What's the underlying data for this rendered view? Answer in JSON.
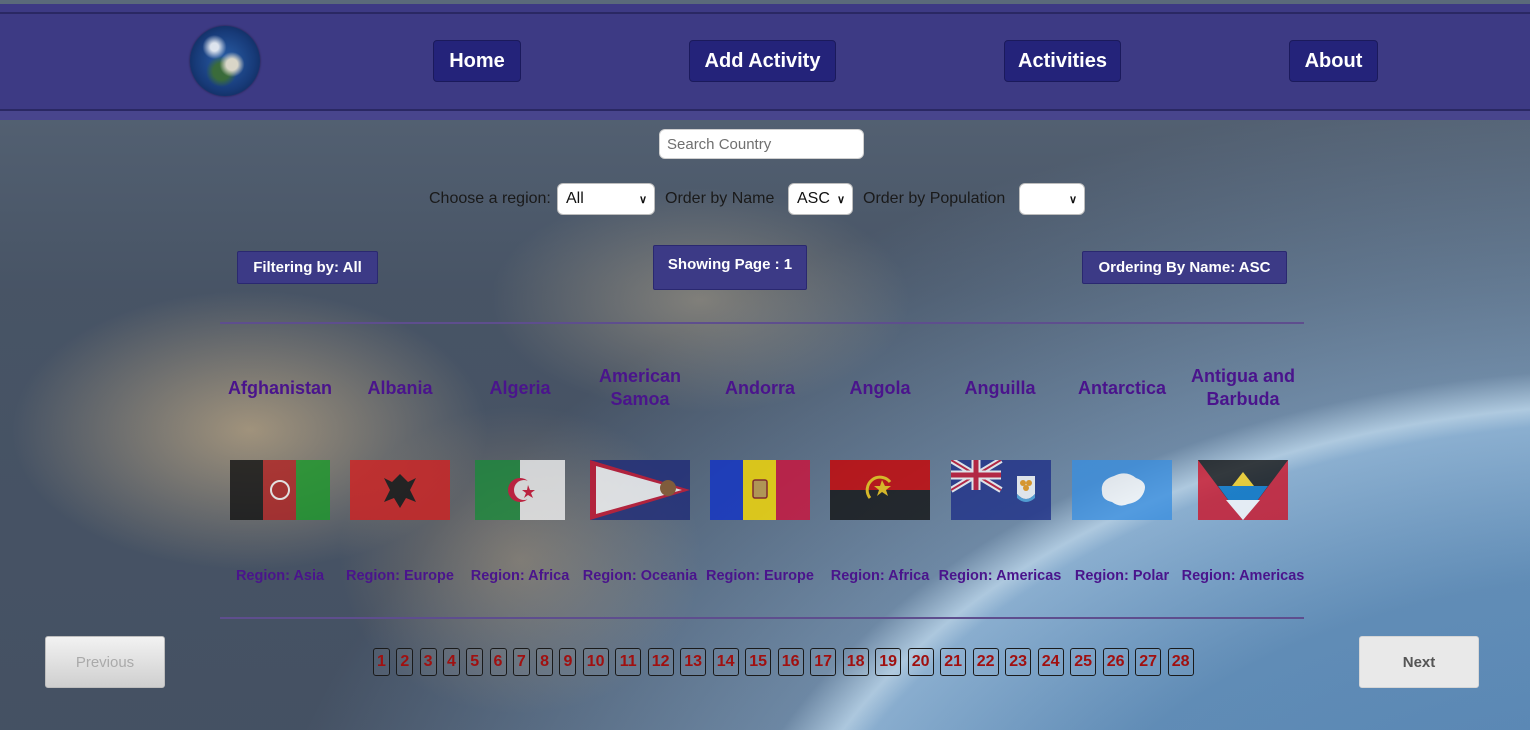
{
  "nav": {
    "items": [
      {
        "label": "Home"
      },
      {
        "label": "Add Activity"
      },
      {
        "label": "Activities"
      },
      {
        "label": "About"
      }
    ]
  },
  "search": {
    "placeholder": "Search Country",
    "value": ""
  },
  "filters": {
    "region_label": "Choose a region:",
    "region_value": "All",
    "name_label": "Order by Name",
    "name_value": "ASC",
    "population_label": "Order by Population",
    "population_value": ""
  },
  "status": {
    "filtering": "Filtering by: All",
    "page": "Showing Page : 1",
    "ordering": "Ordering By Name: ASC"
  },
  "countries": [
    {
      "name": "Afghanistan",
      "region": "Region: Asia",
      "flag": "flag-afghanistan"
    },
    {
      "name": "Albania",
      "region": "Region: Europe",
      "flag": "flag-albania"
    },
    {
      "name": "Algeria",
      "region": "Region: Africa",
      "flag": "flag-algeria"
    },
    {
      "name": "American Samoa",
      "region": "Region: Oceania",
      "flag": "flag-american-samoa"
    },
    {
      "name": "Andorra",
      "region": "Region: Europe",
      "flag": "flag-andorra"
    },
    {
      "name": "Angola",
      "region": "Region: Africa",
      "flag": "flag-angola"
    },
    {
      "name": "Anguilla",
      "region": "Region: Americas",
      "flag": "flag-anguilla"
    },
    {
      "name": "Antarctica",
      "region": "Region: Polar",
      "flag": "flag-antarctica"
    },
    {
      "name": "Antigua and Barbuda",
      "region": "Region: Americas",
      "flag": "flag-antigua-and-barbuda"
    }
  ],
  "pagination": {
    "previous": "Previous",
    "next": "Next",
    "pages": [
      "1",
      "2",
      "3",
      "4",
      "5",
      "6",
      "7",
      "8",
      "9",
      "10",
      "11",
      "12",
      "13",
      "14",
      "15",
      "16",
      "17",
      "18",
      "19",
      "20",
      "21",
      "22",
      "23",
      "24",
      "25",
      "26",
      "27",
      "28"
    ]
  },
  "colors": {
    "navbar": "#3d3a84",
    "button": "#24237a",
    "country_text": "#4a148c",
    "page_number": "#a01010"
  }
}
